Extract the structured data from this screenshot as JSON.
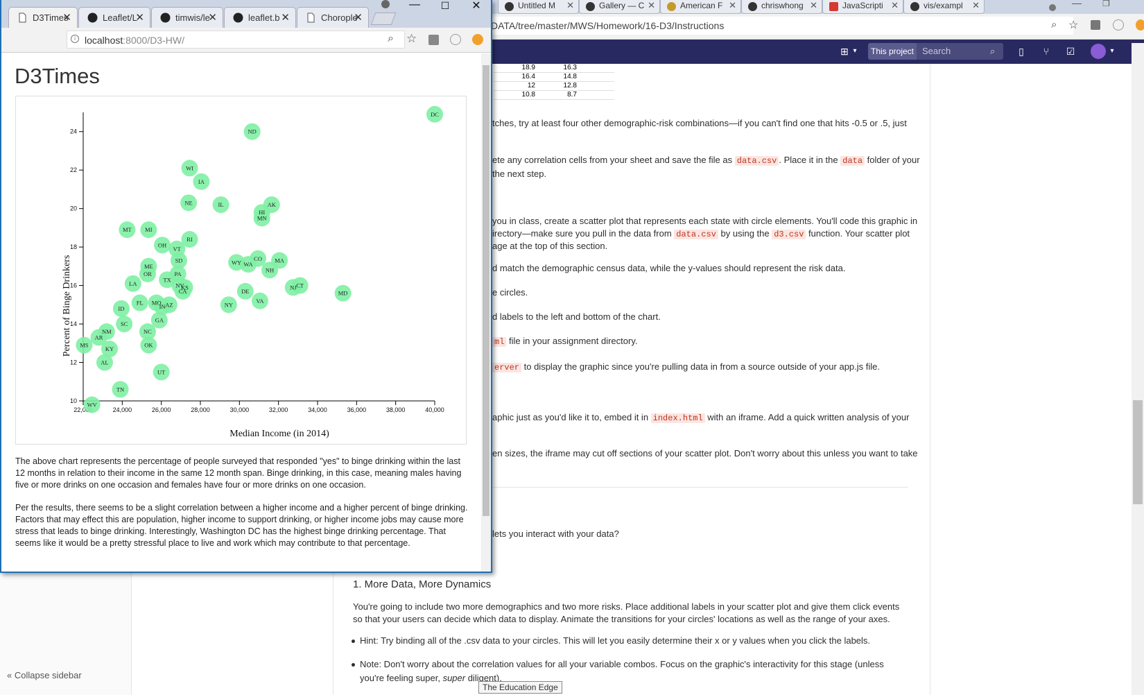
{
  "back_browser": {
    "tabs": [
      {
        "label": "Untitled M",
        "icon": "circle-icon"
      },
      {
        "label": "Gallery — C",
        "icon": "circle-icon"
      },
      {
        "label": "American F",
        "icon": "map-icon"
      },
      {
        "label": "chriswhong",
        "icon": "github-icon"
      },
      {
        "label": "JavaScripti",
        "icon": "js-icon"
      },
      {
        "label": "vis/exampl",
        "icon": "github-icon"
      }
    ],
    "url": "DATA/tree/master/MWS/Homework/16-D3/Instructions",
    "header": {
      "this_project": "This project",
      "search_placeholder": "Search"
    },
    "mini_table": [
      [
        "18.9",
        "16.3"
      ],
      [
        "16.4",
        "14.8"
      ],
      [
        "12",
        "12.8"
      ],
      [
        "10.8",
        "8.7"
      ]
    ],
    "doc": {
      "l1": "tches, try at least four other demographic-risk combinations—if you can't find one that hits -0.5 or .5, just",
      "l2a": "ete any correlation cells from your sheet and save the file as ",
      "code_data_csv": "data.csv",
      "l2b": ". Place it in the ",
      "code_data": "data",
      "l2c": " folder of your",
      "l3": " the next step.",
      "l4": "you in class, create a scatter plot that represents each state with circle elements. You'll code this graphic in",
      "l5a": "irectory—make sure you pull in the data from ",
      "l5b": " by using the ",
      "code_d3csv": "d3.csv",
      "l5c": " function. Your scatter plot",
      "l6": "age at the top of this section.",
      "l7": "d match the demographic census data, while the y-values should represent the risk data.",
      "l8": "e circles.",
      "l9": "d labels to the left and bottom of the chart.",
      "code_ml": "ml",
      "l10": " file in your assignment directory.",
      "code_erver": "erver",
      "l11": " to display the graphic since you're pulling data in from a source outside of your app.js file.",
      "l12a": "aphic just as you'd like it to, embed it in ",
      "code_index": "index.html",
      "l12b": " with an iframe. Add a quick written analysis of your",
      "l13": "en sizes, the iframe may cut off sections of your scatter plot. Don't worry about this unless you want to take",
      "l14": "lets you interact with your data?",
      "h_more": "1. More Data, More Dynamics",
      "p_more": "You're going to include two more demographics and two more risks. Place additional labels in your scatter plot and give them click events so that your users can decide which data to display. Animate the transitions for your circles' locations as well as the range of your axes.",
      "bullet1": "Hint: Try binding all of the .csv data to your circles. This will let you easily determine their x or y values when you click the labels.",
      "bullet2a": "Note: Don't worry about the correlation values for all your variable combos. Focus on the graphic's interactivity for this stage (unless you're feeling super, ",
      "bullet2_em": "super",
      "bullet2b": " diligent)."
    },
    "sidebar_collapse": "Collapse sidebar",
    "tooltip": "The Education Edge"
  },
  "front_browser": {
    "tabs": [
      {
        "label": "D3Times",
        "icon": "document-icon",
        "active": true
      },
      {
        "label": "Leaflet/L",
        "icon": "github-icon"
      },
      {
        "label": "timwis/le",
        "icon": "github-icon"
      },
      {
        "label": "leaflet.b",
        "icon": "github-icon"
      },
      {
        "label": "Chorople",
        "icon": "document-icon"
      }
    ],
    "url_host": "localhost",
    "url_rest": ":8000/D3-HW/",
    "page_title": "D3Times",
    "para1": "The above chart represents the percentage of people surveyed that responded \"yes\" to binge drinking within the last 12 months in relation to their income in the same 12 month span. Binge drinking, in this case, meaning males having five or more drinks on one occasion and females have four or more drinks on one occasion.",
    "para2": "Per the results, there seems to be a slight correlation between a higher income and a higher percent of binge drinking. Factors that may effect this are population, higher income to support drinking, or higher income jobs may cause more stress that leads to binge drinking. Interestingly, Washington DC has the highest binge drinking percentage. That seems like it would be a pretty stressful place to live and work which may contribute to that percentage."
  },
  "chart_data": {
    "type": "scatter",
    "xlabel": "Median Income (in 2014)",
    "ylabel": "Percent of Binge Drinkers",
    "xlim": [
      22000,
      40000
    ],
    "ylim": [
      10,
      25
    ],
    "xticks": [
      22000,
      24000,
      26000,
      28000,
      30000,
      32000,
      34000,
      36000,
      38000,
      40000
    ],
    "xtick_labels": [
      "22,000",
      "24,000",
      "26,000",
      "28,000",
      "30,000",
      "32,000",
      "34,000",
      "36,000",
      "38,000",
      "40,000"
    ],
    "yticks": [
      10,
      12,
      14,
      16,
      18,
      20,
      22,
      24
    ],
    "marker_color": "#7ef0a4",
    "points": [
      {
        "label": "DC",
        "x": 40000,
        "y": 24.9
      },
      {
        "label": "ND",
        "x": 30650,
        "y": 24.0
      },
      {
        "label": "WI",
        "x": 27450,
        "y": 22.1
      },
      {
        "label": "IA",
        "x": 28050,
        "y": 21.4
      },
      {
        "label": "NE",
        "x": 27400,
        "y": 20.3
      },
      {
        "label": "IL",
        "x": 29050,
        "y": 20.2
      },
      {
        "label": "AK",
        "x": 31650,
        "y": 20.2
      },
      {
        "label": "HI",
        "x": 31150,
        "y": 19.8
      },
      {
        "label": "MN",
        "x": 31150,
        "y": 19.5
      },
      {
        "label": "MT",
        "x": 24250,
        "y": 18.9
      },
      {
        "label": "MI",
        "x": 25350,
        "y": 18.9
      },
      {
        "label": "RI",
        "x": 27450,
        "y": 18.4
      },
      {
        "label": "OH",
        "x": 26050,
        "y": 18.1
      },
      {
        "label": "VT",
        "x": 26800,
        "y": 17.9
      },
      {
        "label": "SD",
        "x": 26900,
        "y": 17.3
      },
      {
        "label": "CO",
        "x": 30950,
        "y": 17.4
      },
      {
        "label": "MA",
        "x": 32050,
        "y": 17.3
      },
      {
        "label": "WY",
        "x": 29850,
        "y": 17.2
      },
      {
        "label": "WA",
        "x": 30450,
        "y": 17.1
      },
      {
        "label": "NH",
        "x": 31550,
        "y": 16.8
      },
      {
        "label": "ME",
        "x": 25350,
        "y": 17.0
      },
      {
        "label": "OR",
        "x": 25300,
        "y": 16.6
      },
      {
        "label": "PA",
        "x": 26850,
        "y": 16.6
      },
      {
        "label": "TX",
        "x": 26300,
        "y": 16.3
      },
      {
        "label": "NJ",
        "x": 32750,
        "y": 15.9
      },
      {
        "label": "CT",
        "x": 33100,
        "y": 16.0
      },
      {
        "label": "KS",
        "x": 27200,
        "y": 15.9
      },
      {
        "label": "NV",
        "x": 26950,
        "y": 16.0
      },
      {
        "label": "CA",
        "x": 27100,
        "y": 15.7
      },
      {
        "label": "LA",
        "x": 24550,
        "y": 16.1
      },
      {
        "label": "MD",
        "x": 35300,
        "y": 15.6
      },
      {
        "label": "DE",
        "x": 30300,
        "y": 15.7
      },
      {
        "label": "FL",
        "x": 24900,
        "y": 15.1
      },
      {
        "label": "MO",
        "x": 25750,
        "y": 15.1
      },
      {
        "label": "IN",
        "x": 26050,
        "y": 14.9
      },
      {
        "label": "AZ",
        "x": 26400,
        "y": 15.0
      },
      {
        "label": "VA",
        "x": 31050,
        "y": 15.2
      },
      {
        "label": "NY",
        "x": 29450,
        "y": 15.0
      },
      {
        "label": "ID",
        "x": 23950,
        "y": 14.8
      },
      {
        "label": "GA",
        "x": 25900,
        "y": 14.2
      },
      {
        "label": "SC",
        "x": 24100,
        "y": 14.0
      },
      {
        "label": "NM",
        "x": 23200,
        "y": 13.6
      },
      {
        "label": "NC",
        "x": 25300,
        "y": 13.6
      },
      {
        "label": "AR",
        "x": 22800,
        "y": 13.3
      },
      {
        "label": "OK",
        "x": 25350,
        "y": 12.9
      },
      {
        "label": "MS",
        "x": 22050,
        "y": 12.9
      },
      {
        "label": "KY",
        "x": 23350,
        "y": 12.7
      },
      {
        "label": "AL",
        "x": 23100,
        "y": 12.0
      },
      {
        "label": "UT",
        "x": 26000,
        "y": 11.5
      },
      {
        "label": "TN",
        "x": 23900,
        "y": 10.6
      },
      {
        "label": "WV",
        "x": 22450,
        "y": 9.8
      }
    ]
  }
}
